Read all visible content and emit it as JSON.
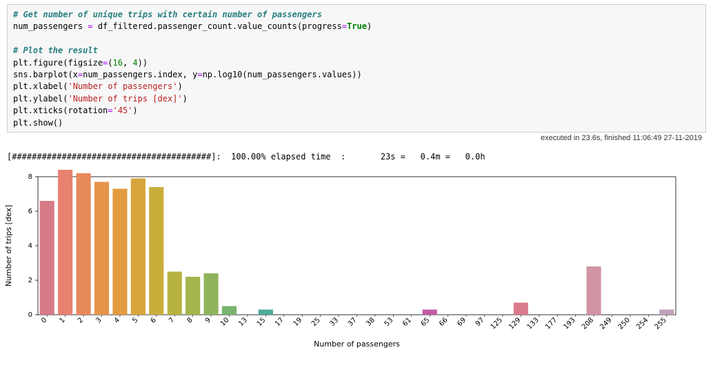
{
  "code": {
    "comment1": "# Get number of unique trips with certain number of passengers",
    "l2_a": "num_passengers ",
    "l2_eq": "=",
    "l2_b": " df_filtered.passenger_count.value_counts(progress",
    "l2_eq2": "=",
    "l2_c": "True",
    "l2_d": ")",
    "comment2": "# Plot the result",
    "l4_a": "plt.figure(figsize",
    "l4_eq": "=",
    "l4_b": "(",
    "l4_n1": "16",
    "l4_c": ", ",
    "l4_n2": "4",
    "l4_d": "))",
    "l5_a": "sns.barplot(x",
    "l5_eq": "=",
    "l5_b": "num_passengers.index, y",
    "l5_eq2": "=",
    "l5_c": "np.log10(num_passengers.values))",
    "l6_a": "plt.xlabel(",
    "l6_s": "'Number of passengers'",
    "l6_b": ")",
    "l7_a": "plt.ylabel(",
    "l7_s": "'Number of trips [dex]'",
    "l7_b": ")",
    "l8_a": "plt.xticks(rotation",
    "l8_eq": "=",
    "l8_s": "'45'",
    "l8_b": ")",
    "l9": "plt.show()"
  },
  "exec": {
    "text": "executed in 23.6s, finished 11:06:49 27-11-2019"
  },
  "progress": {
    "line": "[########################################]:  100.00% elapsed time  :       23s =   0.4m =   0.0h"
  },
  "chart_data": {
    "type": "bar",
    "categories": [
      "0",
      "1",
      "2",
      "3",
      "4",
      "5",
      "6",
      "7",
      "8",
      "9",
      "10",
      "13",
      "15",
      "17",
      "19",
      "25",
      "33",
      "37",
      "38",
      "53",
      "61",
      "65",
      "66",
      "69",
      "97",
      "125",
      "129",
      "133",
      "177",
      "193",
      "208",
      "249",
      "250",
      "254",
      "255"
    ],
    "values": [
      6.6,
      8.9,
      8.2,
      7.7,
      7.3,
      7.9,
      7.4,
      2.5,
      2.2,
      2.4,
      0.5,
      0.0,
      0.3,
      0.0,
      0.0,
      0.0,
      0.0,
      0.0,
      0.0,
      0.0,
      0.0,
      0.3,
      0.0,
      0.0,
      0.0,
      0.0,
      0.7,
      0.0,
      0.0,
      0.0,
      2.8,
      0.0,
      0.0,
      0.0,
      0.3
    ],
    "colors": [
      "#d77a88",
      "#e88270",
      "#e78a5a",
      "#e7944a",
      "#e39c40",
      "#d7a53b",
      "#c9ad3a",
      "#b7b23f",
      "#a4b44a",
      "#8fb35b",
      "#79b36f",
      "#62af85",
      "#4dab99",
      "#43a5aa",
      "#459cb6",
      "#5091be",
      "#6683c1",
      "#7c76c0",
      "#916bbc",
      "#a362b5",
      "#b35cad",
      "#c15ba4",
      "#cb5d9b",
      "#d46293",
      "#d8698e",
      "#da728b",
      "#da7c8d",
      "#d98492",
      "#d78b98",
      "#d5909e",
      "#d294a4",
      "#ce99ab",
      "#c99db1",
      "#c5a0b7",
      "#c0a2bc"
    ],
    "title": "",
    "xlabel": "Number of passengers",
    "ylabel": "Number of trips [dex]",
    "ylim": [
      0,
      8
    ],
    "yticks": [
      0,
      2,
      4,
      6,
      8
    ]
  }
}
